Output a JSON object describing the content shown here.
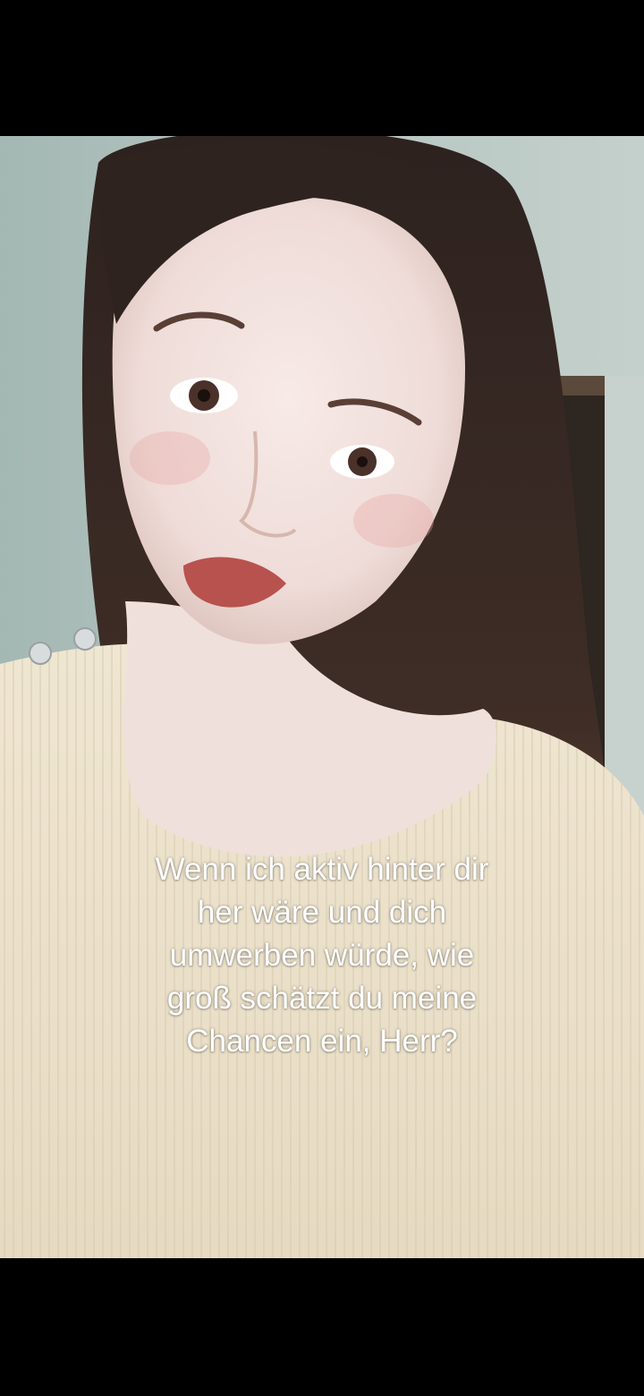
{
  "video": {
    "subject": "video-frame",
    "caption_lines": [
      "Wenn ich aktiv hinter dir",
      "her wäre und dich",
      "umwerben würde, wie",
      "groß schätzt du meine",
      "Chancen ein, Herr?"
    ]
  },
  "colors": {
    "letterbox": "#000000",
    "wall": "#a9bdb8",
    "sweater": "#ece2cc",
    "hair": "#3a2a24",
    "skin": "#f1dfdc",
    "caption_text": "#ffffff"
  }
}
